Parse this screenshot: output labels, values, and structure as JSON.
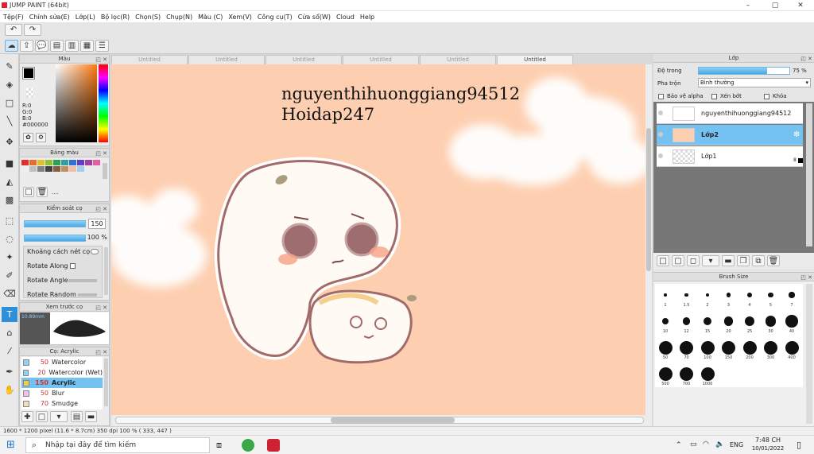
{
  "window": {
    "title": "JUMP PAINT (64bit)"
  },
  "menu": [
    "Tệp(F)",
    "Chỉnh sửa(E)",
    "Lớp(L)",
    "Bộ lọc(R)",
    "Chọn(S)",
    "Chụp(N)",
    "Màu (C)",
    "Xem(V)",
    "Công cụ(T)",
    "Cửa sổ(W)",
    "Cloud",
    "Help"
  ],
  "color_panel": {
    "title": "Màu",
    "r": "R:0",
    "g": "G:0",
    "b": "B:0",
    "hex": "#000000",
    "fg_color": "#000000"
  },
  "swatch_panel": {
    "title": "Bảng màu",
    "dots": "....",
    "colors": [
      "#e03030",
      "#e07030",
      "#e0c030",
      "#90c030",
      "#30a050",
      "#30a0a0",
      "#3070d0",
      "#6040c0",
      "#a040a0",
      "#e060a0",
      "#f0f0f0",
      "#c0c0c0",
      "#808080",
      "#404040",
      "#806040",
      "#c09060",
      "#f0c0a0",
      "#a0d0f0"
    ]
  },
  "brush_control": {
    "title": "Kiểm soát cọ",
    "size_value": "150",
    "opacity_value": "100 %",
    "items": [
      "Khoảng cách nét cọ",
      "Rotate Along",
      "Rotate Angle",
      "Rotate Random"
    ]
  },
  "brush_preview": {
    "title": "Xem trước cọ",
    "size": "10.89mm"
  },
  "brush_list": {
    "title": "Cọ: Acrylic",
    "items": [
      {
        "num": "50",
        "name": "Watercolor",
        "color": "#8fd0f5"
      },
      {
        "num": "20",
        "name": "Watercolor (Wet)",
        "color": "#8fd0f5"
      },
      {
        "num": "150",
        "name": "Acrylic",
        "color": "#f0d040",
        "active": true
      },
      {
        "num": "50",
        "name": "Blur",
        "color": "#f0c0f0"
      },
      {
        "num": "70",
        "name": "Smudge",
        "color": "#f0e0c0"
      }
    ]
  },
  "tabs": [
    "Untitled",
    "Untitled",
    "Untitled",
    "Untitled",
    "Untitled",
    "Untitled"
  ],
  "canvas": {
    "watermark_line1": "nguyenthihuonggiang94512",
    "watermark_line2": "Hoidap247"
  },
  "layer_panel": {
    "title": "Lớp",
    "opacity_label": "Độ trong",
    "opacity_value": "75 %",
    "opacity_fraction": 0.75,
    "blend_label": "Pha trộn",
    "blend_value": "Bình thường",
    "protect_alpha": "Bảo vệ alpha",
    "clipping": "Xén bớt",
    "lock": "Khóa",
    "layers": [
      {
        "name": "nguyenthihuonggiang94512",
        "active": false
      },
      {
        "name": "Lớp2",
        "active": true
      },
      {
        "name": "Lớp1",
        "active": false,
        "badge": "8"
      }
    ]
  },
  "brush_size": {
    "title": "Brush Size",
    "sizes": [
      "1",
      "1.5",
      "2",
      "3",
      "4",
      "5",
      "7",
      "10",
      "12",
      "15",
      "20",
      "25",
      "30",
      "40",
      "50",
      "70",
      "100",
      "150",
      "200",
      "300",
      "400",
      "500",
      "700",
      "1000"
    ]
  },
  "status": {
    "text": "1600 * 1200 pixel    (11.6 * 8.7cm)    350 dpi    100 %    ( 333, 447 )"
  },
  "taskbar": {
    "search_placeholder": "Nhập tại đây để tìm kiếm",
    "lang": "ENG",
    "time": "7:48 CH",
    "date": "10/01/2022"
  }
}
